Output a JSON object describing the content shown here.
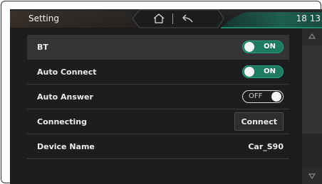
{
  "status_bar": {
    "title": "Setting",
    "time": "18 13",
    "accent_color": "#1f8a6e",
    "home_icon": "home-icon",
    "back_icon": "back-icon"
  },
  "settings": {
    "bt": {
      "label": "BT",
      "state": "ON"
    },
    "auto_connect": {
      "label": "Auto Connect",
      "state": "ON"
    },
    "auto_answer": {
      "label": "Auto Answer",
      "state": "OFF"
    },
    "connecting": {
      "label": "Connecting",
      "button": "Connect"
    },
    "device_name": {
      "label": "Device Name",
      "value": "Car_S90"
    }
  },
  "scrollbar": {
    "up_icon": "triangle-up-icon",
    "down_icon": "triangle-down-icon",
    "position_fraction": 0.0,
    "visible_fraction": 0.72
  }
}
